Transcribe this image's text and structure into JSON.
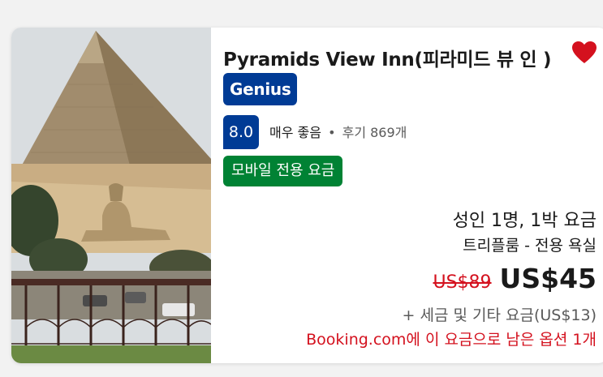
{
  "listing": {
    "title": "Pyramids View Inn(피라미드 뷰 인 )",
    "photo": "pyramid-sphinx-photo",
    "saved": true,
    "genius_label": "Genius",
    "score": "8.0",
    "rating_word": "매우 좋음",
    "separator": "•",
    "reviews": "후기 869개",
    "mobile_badge": "모바일 전용 요금",
    "occupancy": "성인 1명, 1박 요금",
    "room_type": "트리플룸 - 전용 욕실",
    "old_price": "US$89",
    "new_price": "US$45",
    "taxes": "+ 세금 및 기타 요금(US$13)",
    "availability_note": "Booking.com에 이 요금으로 남은 옵션 1개"
  },
  "colors": {
    "brand_blue": "#003b95",
    "deal_green": "#008234",
    "heart_red": "#d4111e",
    "strike_red": "#d4111e"
  }
}
